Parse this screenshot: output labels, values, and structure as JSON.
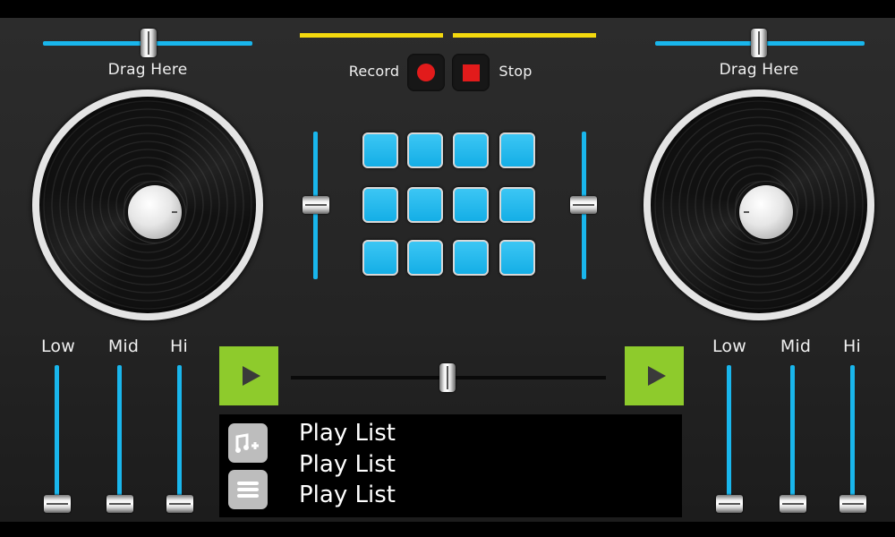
{
  "colors": {
    "accent": "#19b6ec",
    "pad": "#1eb5ea",
    "play": "#8ecb2c",
    "record": "#e21b1b",
    "level": "#f4d90e"
  },
  "deck_left": {
    "drag_label": "Drag Here",
    "pitch_position": 0.5
  },
  "deck_right": {
    "drag_label": "Drag Here",
    "pitch_position": 0.5
  },
  "transport": {
    "record_label": "Record",
    "stop_label": "Stop"
  },
  "pads": {
    "rows": 3,
    "cols": 4
  },
  "volume": {
    "left_position": 0.5,
    "right_position": 0.5
  },
  "eq_left": [
    {
      "label": "Low",
      "level": 0.0
    },
    {
      "label": "Mid",
      "level": 0.0
    },
    {
      "label": "Hi",
      "level": 0.0
    }
  ],
  "eq_right": [
    {
      "label": "Low",
      "level": 0.0
    },
    {
      "label": "Mid",
      "level": 0.0
    },
    {
      "label": "Hi",
      "level": 0.0
    }
  ],
  "crossfader": {
    "position": 0.5
  },
  "playlist": {
    "add_icon": "music-add-icon",
    "menu_icon": "menu-icon",
    "items": [
      "Play List",
      "Play List",
      "Play List"
    ]
  }
}
